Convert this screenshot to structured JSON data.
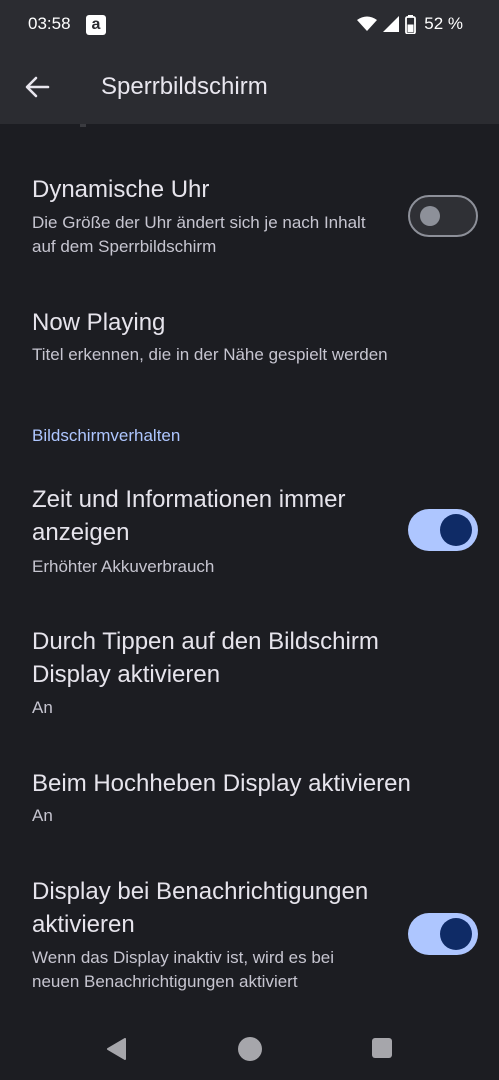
{
  "status": {
    "time": "03:58",
    "battery_percent": "52 %"
  },
  "header": {
    "title": "Sperrbildschirm"
  },
  "settings": {
    "dynamic_clock": {
      "title": "Dynamische Uhr",
      "subtitle": "Die Größe der Uhr ändert sich je nach Inhalt auf dem Sperrbildschirm",
      "enabled": false
    },
    "now_playing": {
      "title": "Now Playing",
      "subtitle": "Titel erkennen, die in der Nähe gespielt werden"
    },
    "section_screen_behavior": "Bildschirmverhalten",
    "always_show_time": {
      "title": "Zeit und Informationen immer anzeigen",
      "subtitle": "Erhöhter Akkuverbrauch",
      "enabled": true
    },
    "tap_to_wake": {
      "title": "Durch Tippen auf den Bildschirm Display aktivieren",
      "subtitle": "An"
    },
    "lift_to_wake": {
      "title": "Beim Hochheben Display aktivieren",
      "subtitle": "An"
    },
    "wake_on_notification": {
      "title": "Display bei Benachrichtigungen aktivieren",
      "subtitle": "Wenn das Display inaktiv ist, wird es bei neuen Benachrichtigungen aktiviert",
      "enabled": true
    }
  },
  "colors": {
    "background": "#1c1d22",
    "appbar": "#2b2c31",
    "accent": "#aec6ff",
    "toggle_thumb_on": "#0f2b66"
  },
  "icons": {
    "status": [
      "wifi-icon",
      "signal-icon",
      "battery-icon"
    ],
    "nav": [
      "nav-back-icon",
      "nav-home-icon",
      "nav-recents-icon"
    ]
  }
}
